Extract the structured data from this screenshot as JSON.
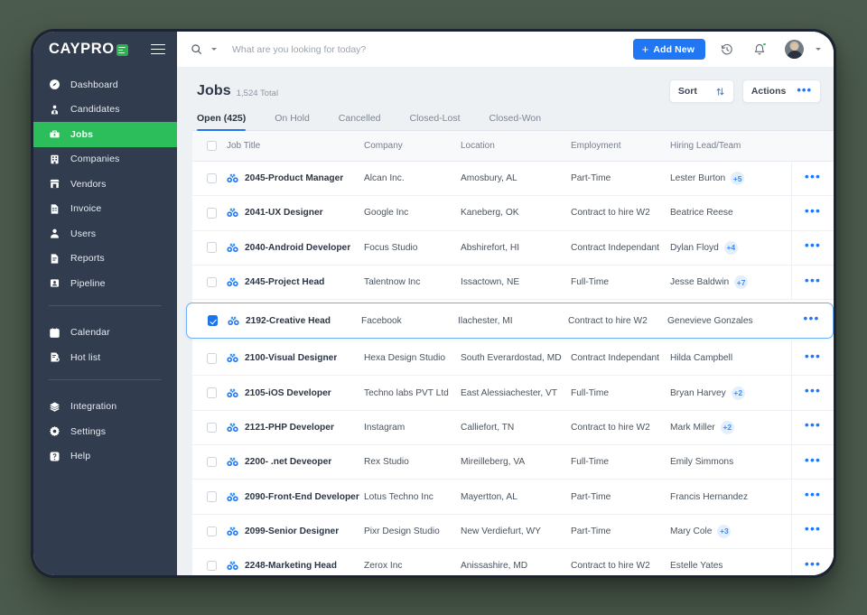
{
  "brand": {
    "name": "CAYPRO",
    "badge_color": "#2bb14e",
    "sidebar_color": "#313d4f",
    "accent_blue": "#2176f3",
    "accent_green": "#2dbe5c"
  },
  "sidebar": {
    "groups": [
      {
        "items": [
          {
            "label": "Dashboard",
            "icon": "dashboard-icon",
            "active": false
          },
          {
            "label": "Candidates",
            "icon": "candidates-icon",
            "active": false
          },
          {
            "label": "Jobs",
            "icon": "jobs-briefcase-icon",
            "active": true
          },
          {
            "label": "Companies",
            "icon": "companies-building-icon",
            "active": false
          },
          {
            "label": "Vendors",
            "icon": "vendors-store-icon",
            "active": false
          },
          {
            "label": "Invoice",
            "icon": "invoice-document-icon",
            "active": false
          },
          {
            "label": "Users",
            "icon": "users-person-icon",
            "active": false
          },
          {
            "label": "Reports",
            "icon": "reports-document-icon",
            "active": false
          },
          {
            "label": "Pipeline",
            "icon": "pipeline-icon",
            "active": false
          }
        ]
      },
      {
        "items": [
          {
            "label": "Calendar",
            "icon": "calendar-icon",
            "active": false
          },
          {
            "label": "Hot list",
            "icon": "hot-list-icon",
            "active": false
          }
        ]
      },
      {
        "items": [
          {
            "label": "Integration",
            "icon": "integration-layers-icon",
            "active": false
          },
          {
            "label": "Settings",
            "icon": "settings-gear-icon",
            "active": false
          },
          {
            "label": "Help",
            "icon": "help-question-icon",
            "active": false
          }
        ]
      }
    ]
  },
  "topbar": {
    "search_placeholder": "What are you looking for today?",
    "search_value": "",
    "add_new_label": "Add New",
    "add_new_plus": "+",
    "history_icon": "history-clock-icon",
    "notification_icon": "bell-icon",
    "notification_has_dot": true,
    "avatar_icon": "user-avatar"
  },
  "page": {
    "title": "Jobs",
    "count_label": "1,524 Total",
    "sort_label": "Sort",
    "actions_label": "Actions",
    "tabs": [
      {
        "label": "Open (425)",
        "active": true
      },
      {
        "label": "On Hold",
        "active": false
      },
      {
        "label": "Cancelled",
        "active": false
      },
      {
        "label": "Closed-Lost",
        "active": false
      },
      {
        "label": "Closed-Won",
        "active": false
      }
    ]
  },
  "table": {
    "columns": [
      "Job Title",
      "Company",
      "Location",
      "Employment",
      "Hiring Lead/Team"
    ],
    "rows": [
      {
        "title": "2045-Product Manager",
        "company": "Alcan Inc.",
        "location": "Amosbury, AL",
        "employment": "Part-Time",
        "lead": "Lester Burton",
        "extra": "+5",
        "selected": false
      },
      {
        "title": "2041-UX Designer",
        "company": "Google Inc",
        "location": "Kaneberg, OK",
        "employment": "Contract to hire W2",
        "lead": "Beatrice Reese",
        "extra": "",
        "selected": false
      },
      {
        "title": "2040-Android Developer",
        "company": "Focus Studio",
        "location": "Abshirefort, HI",
        "employment": "Contract Independant",
        "lead": "Dylan Floyd",
        "extra": "+4",
        "selected": false
      },
      {
        "title": "2445-Project Head",
        "company": "Talentnow Inc",
        "location": "Issactown, NE",
        "employment": "Full-Time",
        "lead": "Jesse Baldwin",
        "extra": "+7",
        "selected": false
      },
      {
        "title": "2192-Creative Head",
        "company": "Facebook",
        "location": "Ilachester, MI",
        "employment": "Contract to hire W2",
        "lead": "Genevieve Gonzales",
        "extra": "",
        "selected": true
      },
      {
        "title": "2100-Visual Designer",
        "company": "Hexa Design Studio",
        "location": "South Everardostad, MD",
        "employment": "Contract Independant",
        "lead": "Hilda Campbell",
        "extra": "",
        "selected": false
      },
      {
        "title": "2105-iOS Developer",
        "company": "Techno labs PVT Ltd",
        "location": "East Alessiachester, VT",
        "employment": "Full-Time",
        "lead": "Bryan Harvey",
        "extra": "+2",
        "selected": false
      },
      {
        "title": "2121-PHP Developer",
        "company": "Instagram",
        "location": "Calliefort, TN",
        "employment": "Contract to hire W2",
        "lead": "Mark Miller",
        "extra": "+2",
        "selected": false
      },
      {
        "title": "2200- .net Deveoper",
        "company": "Rex Studio",
        "location": "Mireilleberg, VA",
        "employment": "Full-Time",
        "lead": "Emily Simmons",
        "extra": "",
        "selected": false
      },
      {
        "title": "2090-Front-End Developer",
        "company": "Lotus Techno Inc",
        "location": "Mayertton, AL",
        "employment": "Part-Time",
        "lead": "Francis Hernandez",
        "extra": "",
        "selected": false
      },
      {
        "title": "2099-Senior Designer",
        "company": "Pixr Design Studio",
        "location": "New Verdiefurt, WY",
        "employment": "Part-Time",
        "lead": "Mary Cole",
        "extra": "+3",
        "selected": false
      },
      {
        "title": "2248-Marketing Head",
        "company": "Zerox Inc",
        "location": "Anissashire, MD",
        "employment": "Contract to hire W2",
        "lead": "Estelle Yates",
        "extra": "",
        "selected": false
      }
    ],
    "row_icon": "binoculars-icon",
    "row_more_icon": "more-horizontal-icon"
  }
}
